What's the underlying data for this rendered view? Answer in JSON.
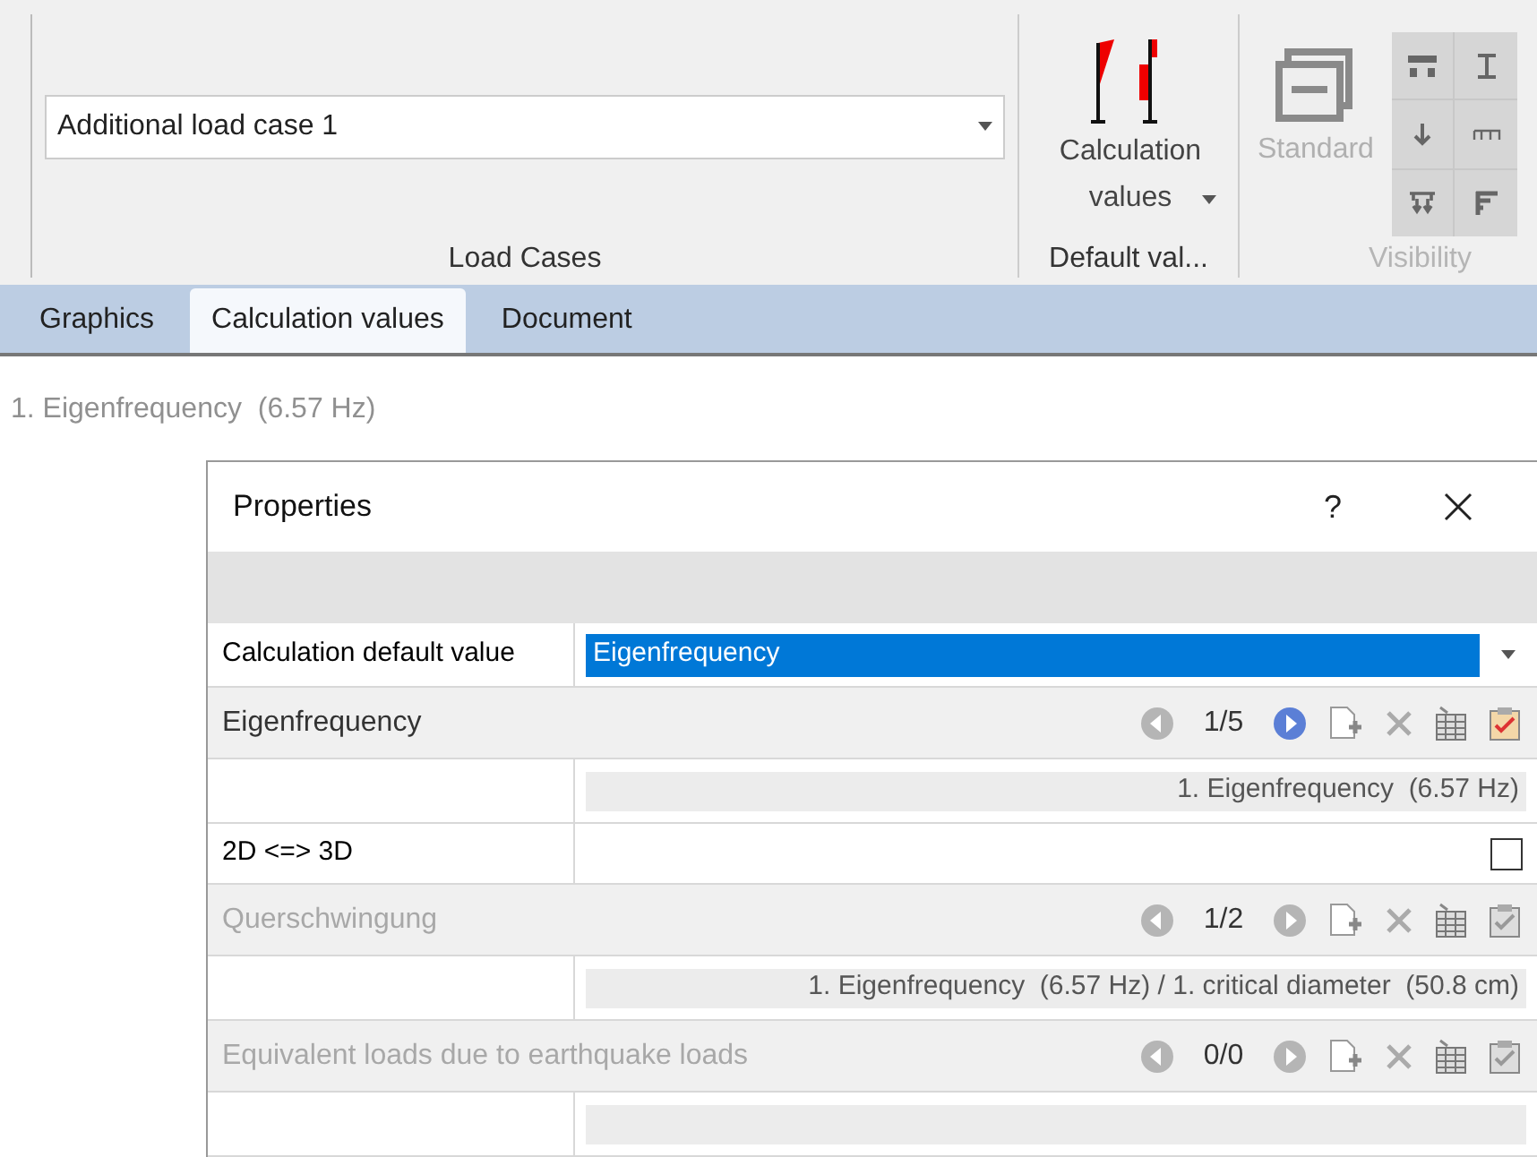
{
  "ribbon": {
    "load_case_select": {
      "value": "Additional load case 1"
    },
    "load_cases_label": "Load Cases",
    "calculation_values_button": {
      "label": "Calculation values"
    },
    "default_values_label": "Default val...",
    "standard_button": {
      "label": "Standard",
      "disabled": true
    },
    "visibility_label": "Visibility"
  },
  "tabs": [
    {
      "label": "Graphics",
      "selected": false
    },
    {
      "label": "Calculation values",
      "selected": true
    },
    {
      "label": "Document",
      "selected": false
    }
  ],
  "result_heading": "1. Eigenfrequency  (6.57 Hz)",
  "properties_dialog": {
    "title": "Properties",
    "help": "?",
    "rows": [
      {
        "kind": "select",
        "label": "Calculation default value",
        "value": "Eigenfrequency"
      },
      {
        "kind": "section",
        "title": "Eigenfrequency",
        "counter": "1/5",
        "disabled": false
      },
      {
        "kind": "value",
        "text": "1. Eigenfrequency  (6.57 Hz)"
      },
      {
        "kind": "checkbox",
        "label": "2D <=> 3D",
        "checked": false
      },
      {
        "kind": "section",
        "title": "Querschwingung",
        "counter": "1/2",
        "disabled": true
      },
      {
        "kind": "value",
        "text": "1. Eigenfrequency  (6.57 Hz) / 1. critical diameter  (50.8 cm)"
      },
      {
        "kind": "section",
        "title": "Equivalent loads due to earthquake loads",
        "counter": "0/0",
        "disabled": true
      },
      {
        "kind": "value",
        "text": ""
      }
    ]
  }
}
